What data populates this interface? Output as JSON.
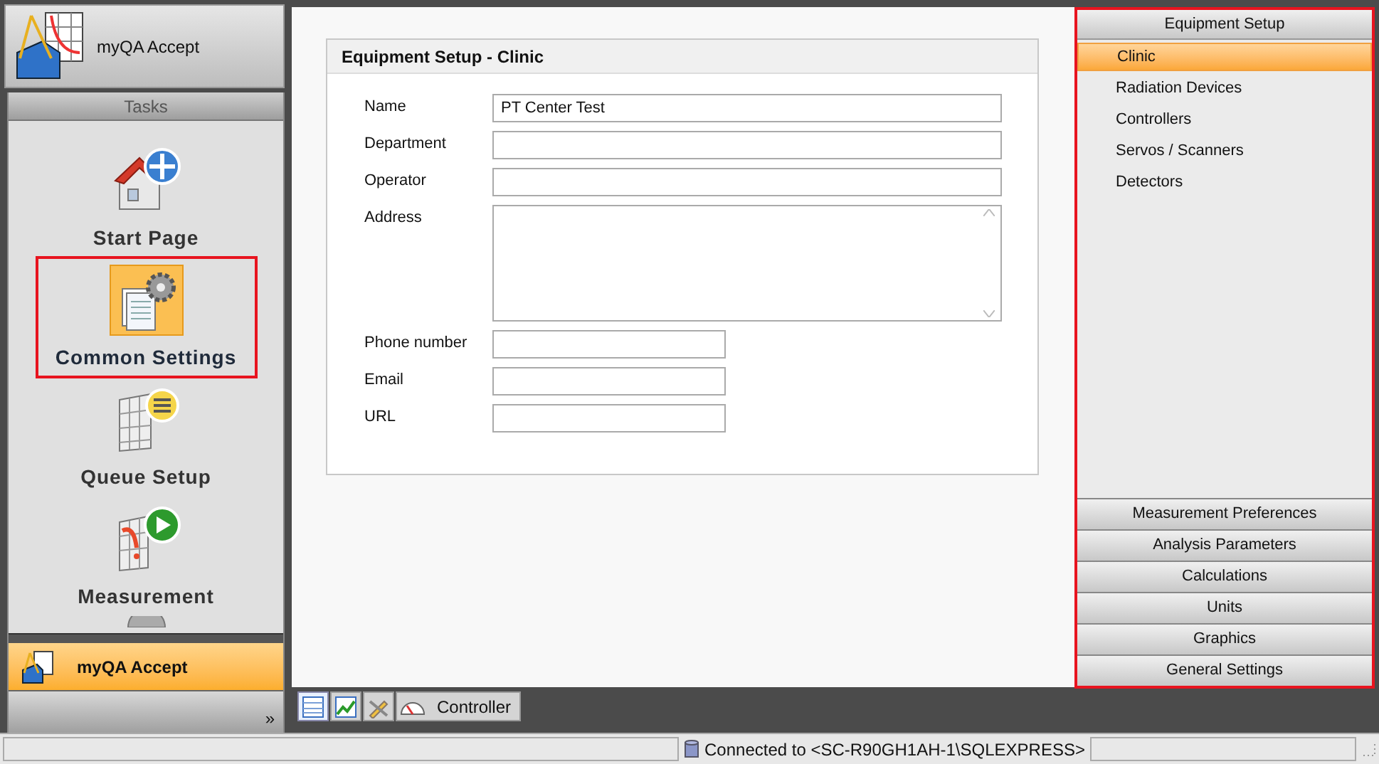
{
  "app": {
    "title": "myQA Accept"
  },
  "tasks": {
    "title": "Tasks",
    "items": [
      {
        "kind": "home",
        "label": "Start Page",
        "selected": false,
        "highlighted": false
      },
      {
        "kind": "settings",
        "label": "Common Settings",
        "selected": true,
        "highlighted": true
      },
      {
        "kind": "queue",
        "label": "Queue Setup",
        "selected": false,
        "highlighted": false
      },
      {
        "kind": "measure",
        "label": "Measurement",
        "selected": false,
        "highlighted": false
      },
      {
        "kind": "cut"
      }
    ]
  },
  "modules": [
    {
      "label": "myQA Accept",
      "selected": true
    }
  ],
  "overflow": "»",
  "form": {
    "title": "Equipment Setup - Clinic",
    "fields": [
      {
        "kind": "text",
        "label": "Name",
        "value": "PT Center Test"
      },
      {
        "kind": "text",
        "label": "Department"
      },
      {
        "kind": "text",
        "label": "Operator"
      },
      {
        "kind": "textarea",
        "label": "Address"
      },
      {
        "kind": "short",
        "label": "Phone number"
      },
      {
        "kind": "short",
        "label": "Email"
      },
      {
        "kind": "short",
        "label": "URL"
      }
    ]
  },
  "bottom_tabs": [
    {
      "kind": "table",
      "selected": true
    },
    {
      "kind": "chart",
      "selected": false
    },
    {
      "kind": "tools",
      "selected": false
    },
    {
      "kind": "gauge",
      "label": "Controller",
      "selected": false
    }
  ],
  "settings_panel": {
    "highlighted": true,
    "title": "Equipment Setup",
    "items": [
      {
        "label": "Clinic",
        "selected": true
      },
      {
        "label": "Radiation Devices",
        "selected": false
      },
      {
        "label": "Controllers",
        "selected": false
      },
      {
        "label": "Servos / Scanners",
        "selected": false
      },
      {
        "label": "Detectors",
        "selected": false
      }
    ],
    "sections": [
      "Measurement Preferences",
      "Analysis Parameters",
      "Calculations",
      "Units",
      "Graphics",
      "General Settings"
    ]
  },
  "status_bar": {
    "connection": "Connected to <SC-R90GH1AH-1\\SQLEXPRESS>"
  }
}
